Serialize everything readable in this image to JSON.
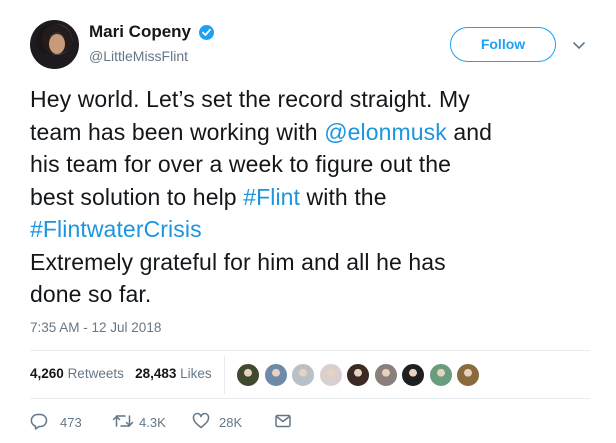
{
  "author": {
    "name": "Mari Copeny",
    "handle": "@LittleMissFlint",
    "avatar": "profile-photo",
    "verified_icon": "verified-badge-icon"
  },
  "header": {
    "follow_label": "Follow",
    "menu_icon": "chevron-down-icon"
  },
  "tweet": {
    "lines": [
      [
        {
          "t": "Hey world. Let’s set the record straight. My",
          "link": false
        }
      ],
      [
        {
          "t": "team has been working with ",
          "link": false
        },
        {
          "t": "@elonmusk",
          "link": true
        },
        {
          "t": " and",
          "link": false
        }
      ],
      [
        {
          "t": "his team for over a week to figure out the",
          "link": false
        }
      ],
      [
        {
          "t": "best solution to help ",
          "link": false
        },
        {
          "t": "#Flint",
          "link": true
        },
        {
          "t": " with the",
          "link": false
        }
      ],
      [
        {
          "t": "#FlintwaterCrisis",
          "link": true
        }
      ],
      [
        {
          "t": "Extremely grateful for him and all he has",
          "link": false
        }
      ],
      [
        {
          "t": "done so far.",
          "link": false
        }
      ]
    ],
    "timestamp": "7:35 AM - 12 Jul 2018"
  },
  "stats": {
    "retweets_count": "4,260",
    "retweets_label": "Retweets",
    "likes_count": "28,483",
    "likes_label": "Likes"
  },
  "likers": [
    "#3f4a2f",
    "#6d8aa8",
    "#b9c0c7",
    "#d9cfcf",
    "#3b2a23",
    "#8a7f7a",
    "#1f1f1f",
    "#6a9c7e",
    "#8b6a3c"
  ],
  "actions": {
    "reply_count": "473",
    "retweet_count": "4.3K",
    "like_count": "28K"
  },
  "colors": {
    "accent": "#1da1f2",
    "link": "#1b95e0",
    "muted": "#657786"
  }
}
